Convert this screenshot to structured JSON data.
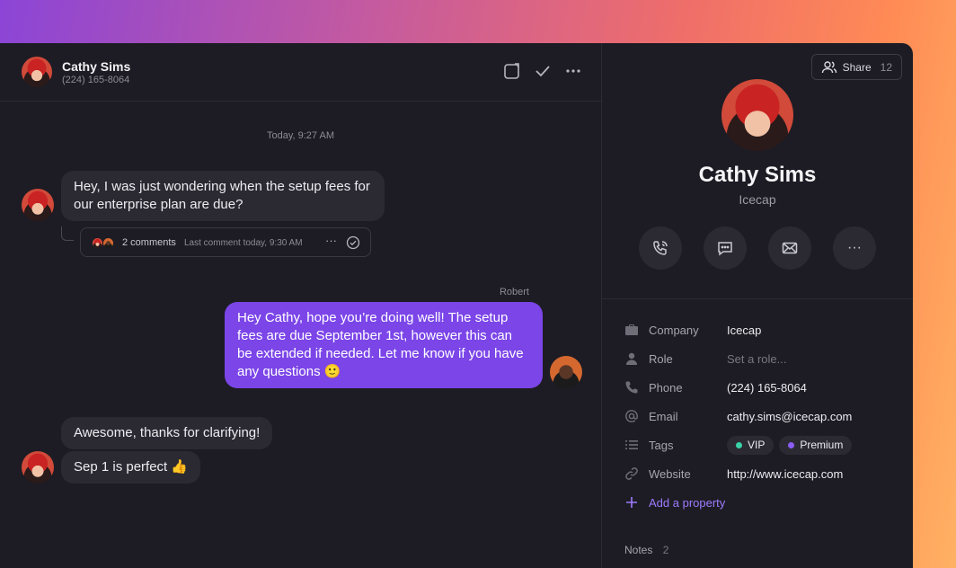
{
  "conversation": {
    "contact_name": "Cathy Sims",
    "contact_phone": "(224) 165-8064",
    "header_icons": [
      "open-panel-icon",
      "check-icon",
      "more-icon"
    ],
    "timestamp": "Today, 9:27 AM",
    "messages": [
      {
        "from": "Cathy",
        "text": "Hey, I was just wondering when the setup fees for our enterprise plan are due?"
      },
      {
        "from": "Robert",
        "sender_label": "Robert",
        "text": "Hey Cathy, hope you’re doing well! The setup fees are due September 1st, however this can be extended if needed. Let me know if you have any questions 🙂"
      },
      {
        "from": "Cathy",
        "text": "Awesome, thanks for clarifying!"
      },
      {
        "from": "Cathy",
        "text": "Sep 1 is perfect 👍"
      }
    ],
    "thread": {
      "count_label": "2 comments",
      "last_label": "Last comment today, 9:30 AM",
      "more": "···"
    }
  },
  "contact": {
    "share_label": "Share",
    "share_count": "12",
    "name": "Cathy Sims",
    "company": "Icecap",
    "actions": [
      "call-icon",
      "message-icon",
      "mail-icon",
      "more-icon"
    ],
    "more_label": "···",
    "properties": [
      {
        "label": "Company",
        "value": "Icecap",
        "icon": "briefcase-icon"
      },
      {
        "label": "Role",
        "value": "Set a role...",
        "icon": "person-icon"
      },
      {
        "label": "Phone",
        "value": "(224) 165-8064",
        "icon": "phone-icon"
      },
      {
        "label": "Email",
        "value": "cathy.sims@icecap.com",
        "icon": "at-icon"
      },
      {
        "label": "Tags",
        "icon": "list-icon",
        "tags": [
          {
            "label": "VIP",
            "color": "#3ad1a8"
          },
          {
            "label": "Premium",
            "color": "#8b5cf6"
          }
        ]
      },
      {
        "label": "Website",
        "value": "http://www.icecap.com",
        "icon": "link-icon"
      }
    ],
    "add_property": "Add a property",
    "notes_label": "Notes",
    "notes_count": "2"
  },
  "colors": {
    "accent": "#7b45e8",
    "panel_bg": "#1d1c24",
    "bubble_in": "#2b2a33"
  }
}
